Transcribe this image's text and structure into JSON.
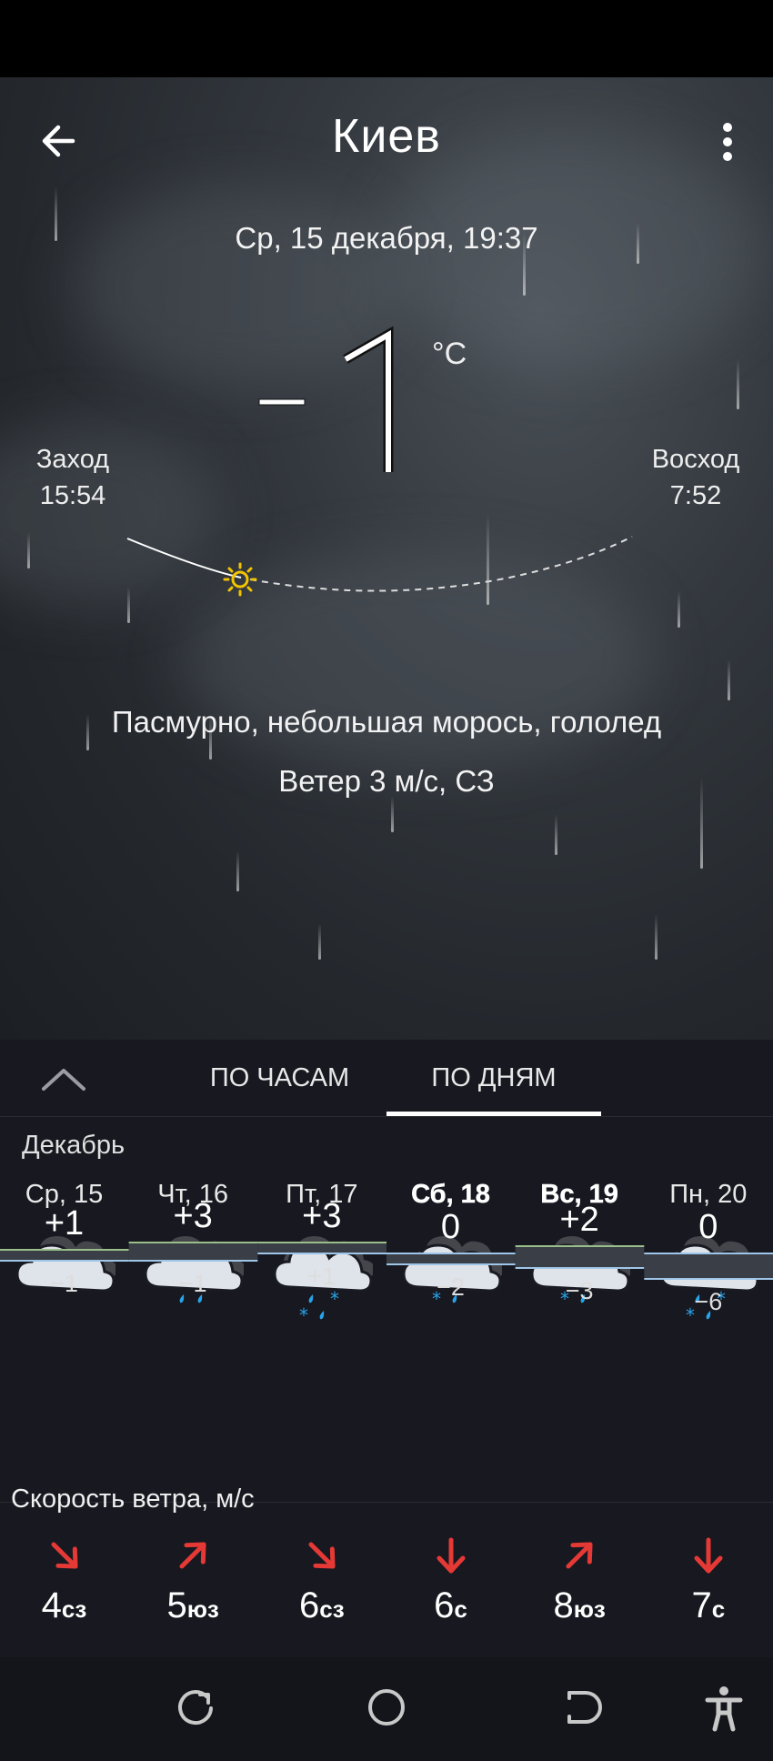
{
  "header": {
    "city": "Киев",
    "date": "Ср, 15 декабря, 19:37",
    "back_icon": "arrow-left-icon",
    "menu_icon": "more-vertical-icon"
  },
  "current": {
    "temperature": "−1",
    "unit": "°C",
    "condition": "Пасмурно, небольшая морось, гололед",
    "wind": "Ветер 3 м/с, СЗ"
  },
  "sun": {
    "sunset_label": "Заход",
    "sunset_time": "15:54",
    "sunrise_label": "Восход",
    "sunrise_time": "7:52"
  },
  "tabs": {
    "hourly": "ПО ЧАСАМ",
    "daily": "ПО ДНЯМ",
    "active": "daily"
  },
  "forecast": {
    "month": "Декабрь",
    "days": [
      {
        "name": "Ср, 15",
        "icon": "cloudy-icon",
        "max": "+1",
        "min": "−1",
        "wind_speed": "4",
        "wind_dir": "сз"
      },
      {
        "name": "Чт, 16",
        "icon": "cloudy-rain-icon",
        "max": "+3",
        "min": "−1",
        "wind_speed": "5",
        "wind_dir": "юз"
      },
      {
        "name": "Пт, 17",
        "icon": "cloudy-sleet-icon",
        "max": "+3",
        "min": "+1",
        "wind_speed": "6",
        "wind_dir": "сз"
      },
      {
        "name": "Сб, 18",
        "icon": "cloudy-sleet-light-icon",
        "max": "0",
        "min": "−2",
        "wind_speed": "6",
        "wind_dir": "с"
      },
      {
        "name": "Вс, 19",
        "icon": "cloudy-sleet-light-icon",
        "max": "+2",
        "min": "−3",
        "wind_speed": "8",
        "wind_dir": "юз"
      },
      {
        "name": "Пн, 20",
        "icon": "cloudy-sleet-icon",
        "max": "0",
        "min": "−6",
        "wind_speed": "7",
        "wind_dir": "с"
      }
    ],
    "wind_title": "Скорость ветра, м/с"
  },
  "colors": {
    "accent_red": "#e53935",
    "precip_blue": "#29a3e8",
    "panel_bg": "#171820"
  }
}
